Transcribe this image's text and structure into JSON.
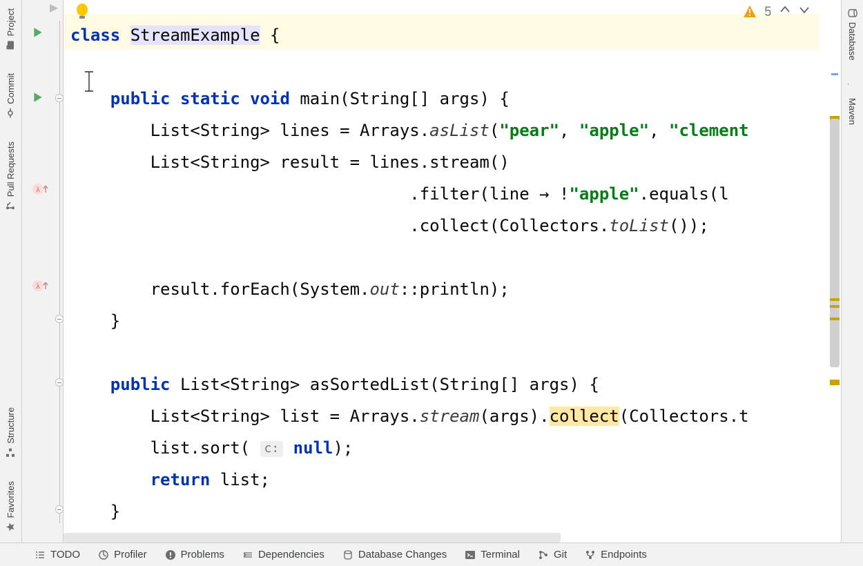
{
  "left_tabs": {
    "project": "Project",
    "commit": "Commit",
    "pull_requests": "Pull Requests",
    "structure": "Structure",
    "favorites": "Favorites"
  },
  "right_tabs": {
    "database": "Database",
    "maven": "Maven"
  },
  "bottom_tabs": {
    "todo": "TODO",
    "profiler": "Profiler",
    "problems": "Problems",
    "dependencies": "Dependencies",
    "db_changes": "Database Changes",
    "terminal": "Terminal",
    "git": "Git",
    "endpoints": "Endpoints"
  },
  "inspection": {
    "count": "5"
  },
  "code": {
    "l1": {
      "class_kw": "class",
      "name": "StreamExample",
      "brace": " {"
    },
    "l2": "",
    "l3": {
      "indent": "    ",
      "public": "public",
      "static": "static",
      "void": "void",
      "sig": " main(String[] args) {"
    },
    "l4": {
      "indent": "        ",
      "decl": "List<String> lines = Arrays.",
      "asList": "asList",
      "open": "(",
      "s1": "\"pear\"",
      "c1": ", ",
      "s2": "\"apple\"",
      "c2": ", ",
      "s3": "\"clement"
    },
    "l5": {
      "indent": "        ",
      "txt": "List<String> result = lines.stream()"
    },
    "l6": {
      "indent": "                                  ",
      "pre": ".filter(line → !",
      "s": "\"apple\"",
      "post": ".equals(l"
    },
    "l7": {
      "indent": "                                  ",
      "pre": ".collect(Collectors.",
      "toList": "toList",
      "post": "());"
    },
    "l8": "",
    "l9": {
      "indent": "        ",
      "pre": "result.forEach(System.",
      "out": "out",
      "post": "::println);"
    },
    "l10": {
      "indent": "    ",
      "brace": "}"
    },
    "l11": "",
    "l12": {
      "indent": "    ",
      "public": "public",
      "sig": " List<String> asSortedList(String[] args) {"
    },
    "l13": {
      "indent": "        ",
      "pre": "List<String> list = Arrays.",
      "stream": "stream",
      "mid": "(args).",
      "collect": "collect",
      "post": "(Collectors.t"
    },
    "l14": {
      "indent": "        ",
      "pre": "list.sort( ",
      "hint": "c:",
      "null": " null",
      "post": ");"
    },
    "l15": {
      "indent": "        ",
      "return": "return",
      "post": " list;"
    },
    "l16": {
      "indent": "    ",
      "brace": "}"
    }
  }
}
